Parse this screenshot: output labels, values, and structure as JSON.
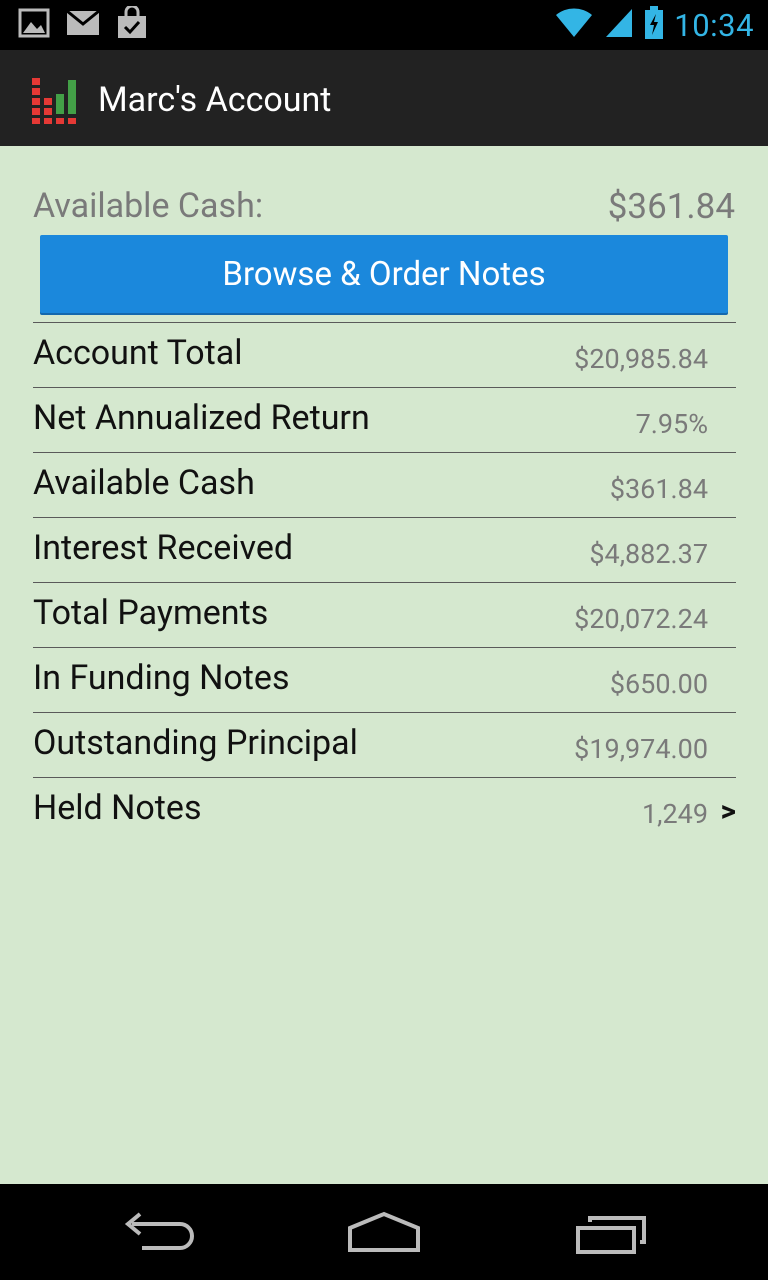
{
  "status_bar": {
    "time": "10:34",
    "icons": [
      "gallery-icon",
      "gmail-icon",
      "shopping-bag-icon",
      "wifi-icon",
      "signal-icon",
      "battery-icon"
    ]
  },
  "action_bar": {
    "title": "Marc's Account",
    "logo": "bar-chart-logo-icon"
  },
  "cash": {
    "label": "Available Cash:",
    "value": "$361.84"
  },
  "browse_button": "Browse & Order Notes",
  "stats": [
    {
      "label": "Account Total",
      "value": "$20,985.84"
    },
    {
      "label": "Net Annualized Return",
      "value": "7.95%"
    },
    {
      "label": "Available Cash",
      "value": "$361.84"
    },
    {
      "label": "Interest Received",
      "value": "$4,882.37"
    },
    {
      "label": "Total Payments",
      "value": "$20,072.24"
    },
    {
      "label": "In Funding Notes",
      "value": "$650.00"
    },
    {
      "label": "Outstanding Principal",
      "value": "$19,974.00"
    },
    {
      "label": "Held Notes",
      "value": "1,249",
      "chevron": ">"
    }
  ],
  "nav": [
    "back-icon",
    "home-icon",
    "recent-apps-icon"
  ],
  "colors": {
    "background": "#d5e8cf",
    "button": "#1b88dc",
    "action_bar": "#222222",
    "clock": "#33b5e5"
  }
}
